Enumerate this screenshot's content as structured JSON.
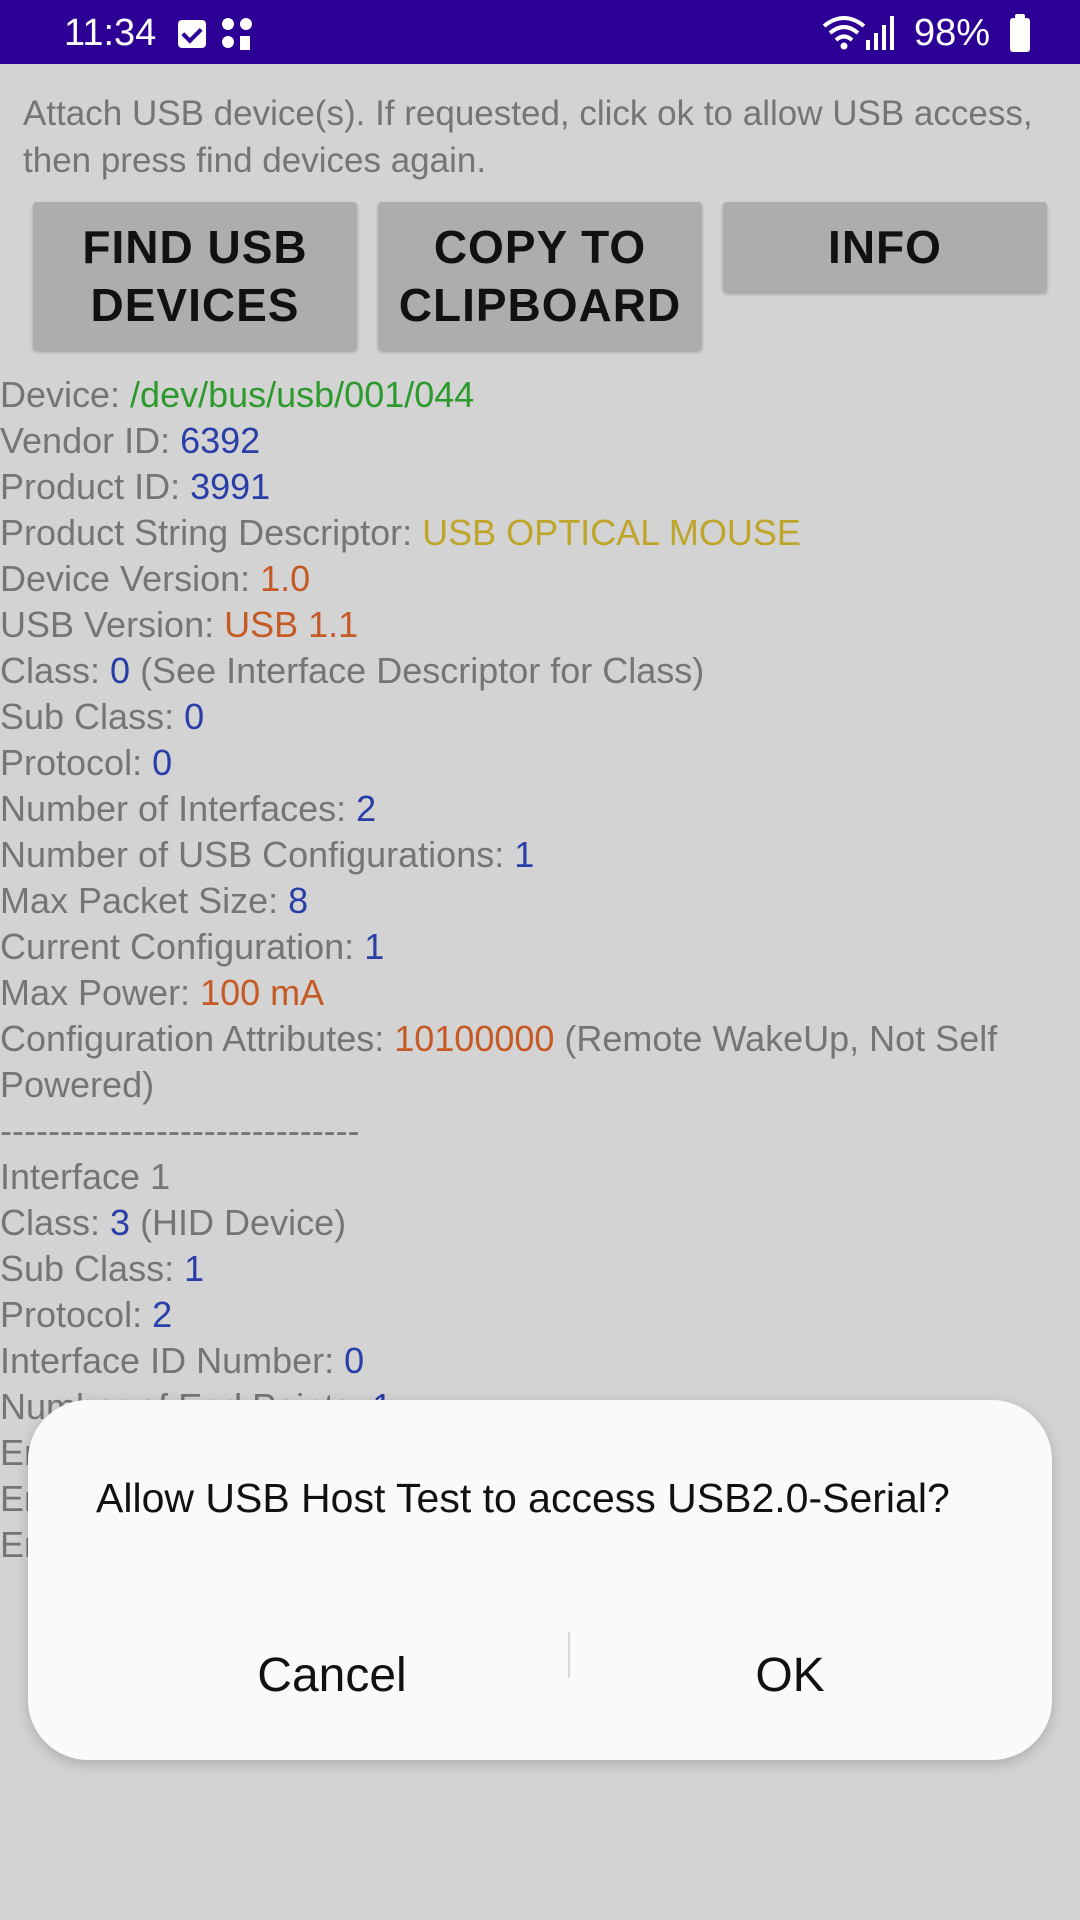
{
  "status_bar": {
    "time": "11:34",
    "battery": "98%",
    "background_color": "#2c0094"
  },
  "instructions": "Attach USB device(s).  If requested, click ok to allow USB access, then press find devices again.",
  "buttons": {
    "find_usb": "FIND USB DEVICES",
    "copy_clipboard": "COPY TO CLIPBOARD",
    "info": "INFO"
  },
  "device": {
    "rows": [
      {
        "label": "Device: ",
        "value": "/dev/bus/usb/001/044",
        "color": "green"
      },
      {
        "label": "Vendor ID: ",
        "value": "6392",
        "color": "blue"
      },
      {
        "label": "Product ID: ",
        "value": "3991",
        "color": "blue"
      },
      {
        "label": "Product String Descriptor: ",
        "value": "USB OPTICAL MOUSE",
        "color": "gold"
      },
      {
        "label": "Device Version: ",
        "value": "1.0",
        "color": "orange"
      },
      {
        "label": "USB Version: ",
        "value": "USB 1.1",
        "color": "orange"
      },
      {
        "label": "Class: ",
        "value": "0",
        "color": "blue",
        "suffix": " (See Interface Descriptor for Class)"
      },
      {
        "label": "Sub Class: ",
        "value": "0",
        "color": "blue"
      },
      {
        "label": "Protocol: ",
        "value": "0",
        "color": "blue"
      },
      {
        "label": "Number of Interfaces: ",
        "value": "2",
        "color": "blue"
      },
      {
        "label": "Number of USB Configurations: ",
        "value": "1",
        "color": "blue"
      },
      {
        "label": "Max Packet Size: ",
        "value": "8",
        "color": "blue"
      },
      {
        "label": "Current Configuration: ",
        "value": "1",
        "color": "blue"
      },
      {
        "label": "Max Power: ",
        "value": "100 mA",
        "color": "orange"
      },
      {
        "label": "Configuration Attributes: ",
        "value": "10100000",
        "color": "orange",
        "suffix": " (Remote WakeUp, Not Self Powered)"
      }
    ],
    "separator": "------------------------------",
    "interface_title": "Interface 1",
    "interface_rows": [
      {
        "label": "Class: ",
        "value": "3",
        "color": "blue",
        "suffix": " (HID Device)"
      },
      {
        "label": "Sub Class: ",
        "value": "1",
        "color": "blue"
      },
      {
        "label": "Protocol: ",
        "value": "2",
        "color": "blue"
      },
      {
        "label": "Interface ID Number: ",
        "value": "0",
        "color": "blue"
      },
      {
        "label": "Number of End Points: ",
        "value": "1",
        "color": "blue"
      }
    ],
    "obscured_rows": [
      "En",
      "En",
      "En"
    ]
  },
  "dialog": {
    "title": "Allow USB Host Test to access USB2.0-Serial?",
    "cancel": "Cancel",
    "ok": "OK"
  },
  "colors": {
    "background": "#d3d3d3",
    "label": "#757575",
    "blue": "#2a3ea8",
    "green": "#2c9a2c",
    "gold": "#bfa52a",
    "orange": "#c55a25"
  }
}
